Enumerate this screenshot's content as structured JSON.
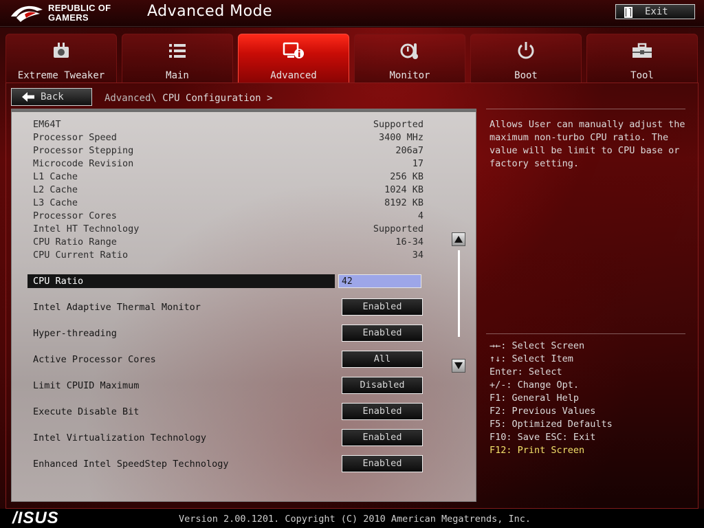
{
  "header": {
    "brand_line1": "REPUBLIC OF",
    "brand_line2": "GAMERS",
    "title": "Advanced Mode",
    "exit_label": "Exit"
  },
  "tabs": [
    {
      "label": "Extreme Tweaker",
      "icon": "tweaker-icon"
    },
    {
      "label": "Main",
      "icon": "list-icon"
    },
    {
      "label": "Advanced",
      "icon": "advanced-info-icon",
      "active": true
    },
    {
      "label": "Monitor",
      "icon": "monitor-gauge-icon"
    },
    {
      "label": "Boot",
      "icon": "power-icon"
    },
    {
      "label": "Tool",
      "icon": "toolbox-icon"
    }
  ],
  "nav": {
    "back_label": "Back",
    "breadcrumb_parent": "Advanced\\",
    "breadcrumb_current": "CPU Configuration",
    "breadcrumb_sep": ">"
  },
  "info": [
    {
      "label": "EM64T",
      "value": "Supported"
    },
    {
      "label": "Processor Speed",
      "value": "3400 MHz"
    },
    {
      "label": "Processor Stepping",
      "value": "206a7"
    },
    {
      "label": "Microcode Revision",
      "value": "17"
    },
    {
      "label": "L1 Cache",
      "value": "256 KB"
    },
    {
      "label": "L2 Cache",
      "value": "1024 KB"
    },
    {
      "label": "L3 Cache",
      "value": "8192 KB"
    },
    {
      "label": "Processor Cores",
      "value": "4"
    },
    {
      "label": "Intel HT Technology",
      "value": "Supported"
    },
    {
      "label": "CPU Ratio Range",
      "value": "16-34"
    },
    {
      "label": "CPU Current Ratio",
      "value": "34"
    }
  ],
  "cpu_ratio": {
    "label": "CPU Ratio",
    "value": "42"
  },
  "options": [
    {
      "label": "Intel Adaptive Thermal Monitor",
      "value": "Enabled"
    },
    {
      "label": "Hyper-threading",
      "value": "Enabled"
    },
    {
      "label": "Active Processor Cores",
      "value": "All"
    },
    {
      "label": "Limit CPUID Maximum",
      "value": "Disabled"
    },
    {
      "label": "Execute Disable Bit",
      "value": "Enabled"
    },
    {
      "label": "Intel Virtualization Technology",
      "value": "Enabled"
    },
    {
      "label": "Enhanced Intel SpeedStep Technology",
      "value": "Enabled"
    }
  ],
  "help": {
    "description": "Allows User can manually adjust the maximum non-turbo CPU ratio. The value will be limit to CPU base or factory setting.",
    "keys": [
      "→←: Select Screen",
      "↑↓: Select Item",
      "Enter: Select",
      "+/-: Change Opt.",
      "F1: General Help",
      "F2: Previous Values",
      "F5: Optimized Defaults",
      "F10: Save  ESC: Exit"
    ],
    "highlight_key": "F12: Print Screen"
  },
  "footer": {
    "logo": "/ISUS",
    "version": "Version 2.00.1201. Copyright (C) 2010 American Megatrends, Inc."
  },
  "colors": {
    "accent": "#c80c06",
    "highlight_text": "#f3e16a",
    "input_bg": "#9da6e8"
  }
}
